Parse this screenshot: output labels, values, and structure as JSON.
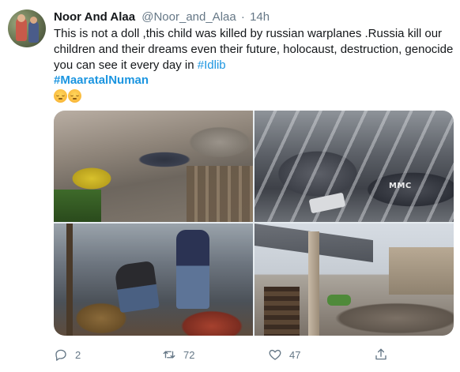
{
  "tweet": {
    "display_name": "Noor And Alaa",
    "handle": "@Noor_and_Alaa",
    "separator": "·",
    "time": "14h",
    "text_main": "This is not a doll ,this child was killed by russian warplanes .Russia kill our children and their dreams even their future, holocaust, destruction, genocide you can see it every day in ",
    "text_hashtag_inline": "#Idlib",
    "hashtag_line": "#MaaratalNuman",
    "emoji_count": 2
  },
  "media": {
    "watermark": "MMC"
  },
  "actions": {
    "reply_count": "2",
    "retweet_count": "72",
    "like_count": "47"
  },
  "icons": {
    "reply": "reply-icon",
    "retweet": "retweet-icon",
    "like": "heart-icon",
    "share": "share-icon"
  },
  "colors": {
    "link": "#1b95e0",
    "muted": "#657786",
    "text": "#14171a"
  }
}
